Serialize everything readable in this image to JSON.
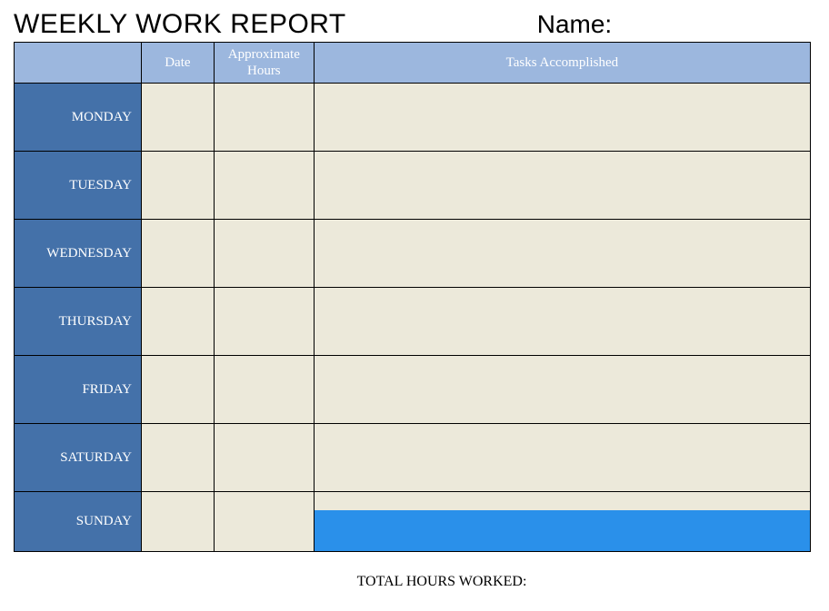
{
  "header": {
    "title": "WEEKLY WORK REPORT",
    "name_label": "Name:"
  },
  "columns": {
    "day": "",
    "date": "Date",
    "hours_line1": "Approximate",
    "hours_line2": "Hours",
    "tasks": "Tasks Accomplished"
  },
  "days": [
    {
      "label": "MONDAY",
      "date": "",
      "hours": "",
      "tasks": ""
    },
    {
      "label": "TUESDAY",
      "date": "",
      "hours": "",
      "tasks": ""
    },
    {
      "label": "WEDNESDAY",
      "date": "",
      "hours": "",
      "tasks": ""
    },
    {
      "label": "THURSDAY",
      "date": "",
      "hours": "",
      "tasks": ""
    },
    {
      "label": "FRIDAY",
      "date": "",
      "hours": "",
      "tasks": ""
    },
    {
      "label": "SATURDAY",
      "date": "",
      "hours": "",
      "tasks": ""
    },
    {
      "label": "SUNDAY",
      "date": "",
      "hours": "",
      "tasks": ""
    }
  ],
  "footer": {
    "total_label": "TOTAL HOURS WORKED:"
  }
}
